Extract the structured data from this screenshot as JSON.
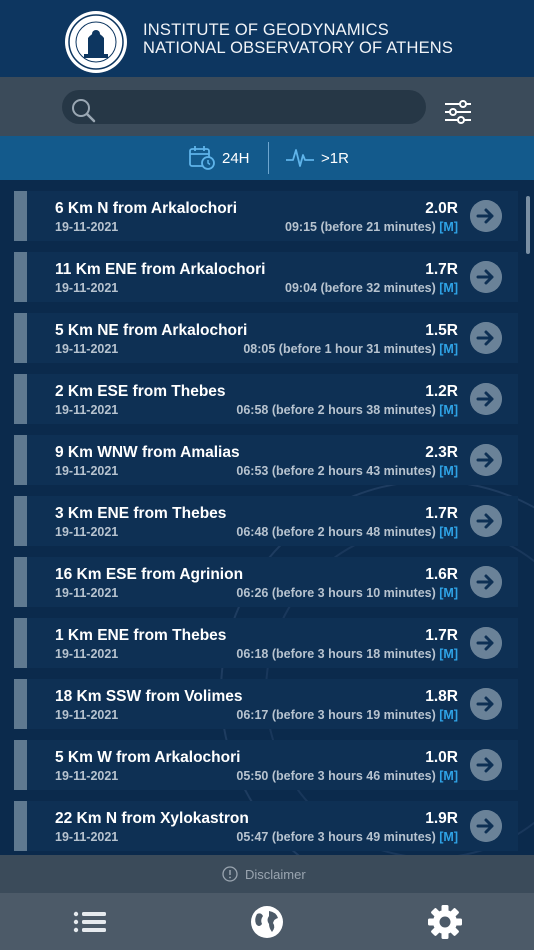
{
  "header": {
    "line1": "INSTITUTE OF GEODYNAMICS",
    "line2": "NATIONAL OBSERVATORY OF ATHENS",
    "logo": "observatory-seal"
  },
  "search": {
    "value": "",
    "placeholder": ""
  },
  "filters": {
    "time_label": "24H",
    "magnitude_label": ">1R"
  },
  "events": [
    {
      "location": "6 Km N from Arkalochori",
      "magnitude": "2.0R",
      "date": "19-11-2021",
      "time": "09:15 (before 21 minutes)",
      "mtype": "[M]"
    },
    {
      "location": "11 Km ENE from Arkalochori",
      "magnitude": "1.7R",
      "date": "19-11-2021",
      "time": "09:04 (before 32 minutes)",
      "mtype": "[M]"
    },
    {
      "location": "5 Km NE from Arkalochori",
      "magnitude": "1.5R",
      "date": "19-11-2021",
      "time": "08:05 (before 1 hour 31 minutes)",
      "mtype": "[M]"
    },
    {
      "location": "2 Km ESE from Thebes",
      "magnitude": "1.2R",
      "date": "19-11-2021",
      "time": "06:58 (before 2 hours 38 minutes)",
      "mtype": "[M]"
    },
    {
      "location": "9 Km WNW from Amalias",
      "magnitude": "2.3R",
      "date": "19-11-2021",
      "time": "06:53 (before 2 hours 43 minutes)",
      "mtype": "[M]"
    },
    {
      "location": "3 Km ENE from Thebes",
      "magnitude": "1.7R",
      "date": "19-11-2021",
      "time": "06:48 (before 2 hours 48 minutes)",
      "mtype": "[M]"
    },
    {
      "location": "16 Km ESE from Agrinion",
      "magnitude": "1.6R",
      "date": "19-11-2021",
      "time": "06:26 (before 3 hours 10 minutes)",
      "mtype": "[M]"
    },
    {
      "location": "1 Km ENE from Thebes",
      "magnitude": "1.7R",
      "date": "19-11-2021",
      "time": "06:18 (before 3 hours 18 minutes)",
      "mtype": "[M]"
    },
    {
      "location": "18 Km SSW from Volimes",
      "magnitude": "1.8R",
      "date": "19-11-2021",
      "time": "06:17 (before 3 hours 19 minutes)",
      "mtype": "[M]"
    },
    {
      "location": "5 Km W from Arkalochori",
      "magnitude": "1.0R",
      "date": "19-11-2021",
      "time": "05:50 (before 3 hours 46 minutes)",
      "mtype": "[M]"
    },
    {
      "location": "22 Km N from Xylokastron",
      "magnitude": "1.9R",
      "date": "19-11-2021",
      "time": "05:47 (before 3 hours 49 minutes)",
      "mtype": "[M]"
    }
  ],
  "disclaimer": "Disclaimer",
  "tabs": [
    {
      "icon": "list-icon"
    },
    {
      "icon": "globe-icon"
    },
    {
      "icon": "gear-icon"
    }
  ],
  "colors": {
    "background": "#0b2a4c",
    "header": "#0d3660",
    "filter_bar": "#135a8c",
    "row": "#0e3054",
    "accent_link": "#2fa3e6",
    "tab_bar": "#4c5a68"
  }
}
